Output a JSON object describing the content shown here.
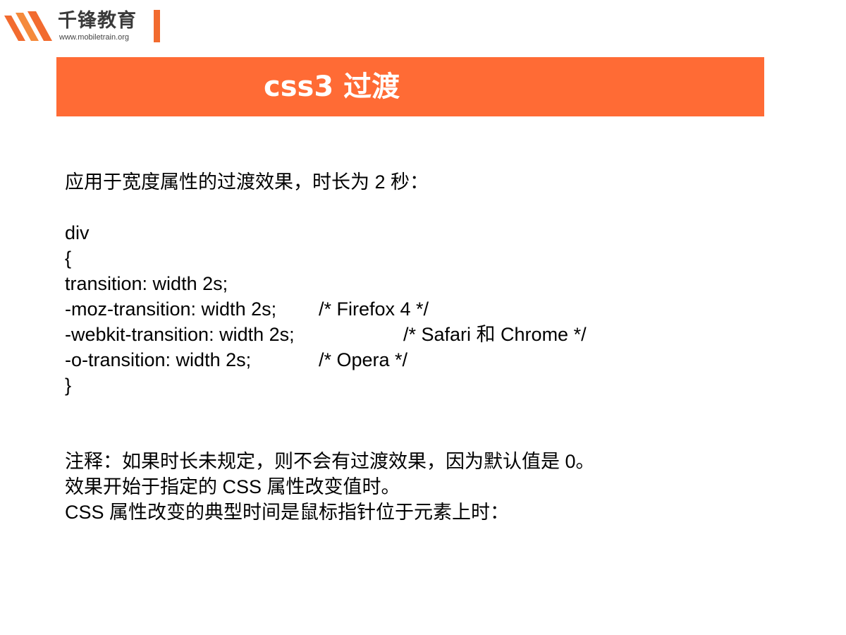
{
  "logo": {
    "name": "千锋教育",
    "url": "www.mobiletrain.org",
    "accent_color": "#f26b2f"
  },
  "title": {
    "text": "css3 过渡",
    "banner_color": "#ff6b35"
  },
  "intro": "应用于宽度属性的过渡效果，时长为 2 秒：",
  "code": {
    "lines": [
      {
        "code": "div",
        "comment": ""
      },
      {
        "code": "{",
        "comment": ""
      },
      {
        "code": "transition: width 2s;",
        "comment": ""
      },
      {
        "code": "-moz-transition: width 2s;",
        "comment": "/* Firefox 4 */"
      },
      {
        "code": "-webkit-transition: width 2s;",
        "comment": "/* Safari 和 Chrome */"
      },
      {
        "code": "-o-transition: width 2s;",
        "comment": "/* Opera */"
      },
      {
        "code": "}",
        "comment": ""
      }
    ]
  },
  "notes": [
    "注释：如果时长未规定，则不会有过渡效果，因为默认值是 0。",
    "效果开始于指定的 CSS 属性改变值时。",
    "CSS 属性改变的典型时间是鼠标指针位于元素上时："
  ]
}
